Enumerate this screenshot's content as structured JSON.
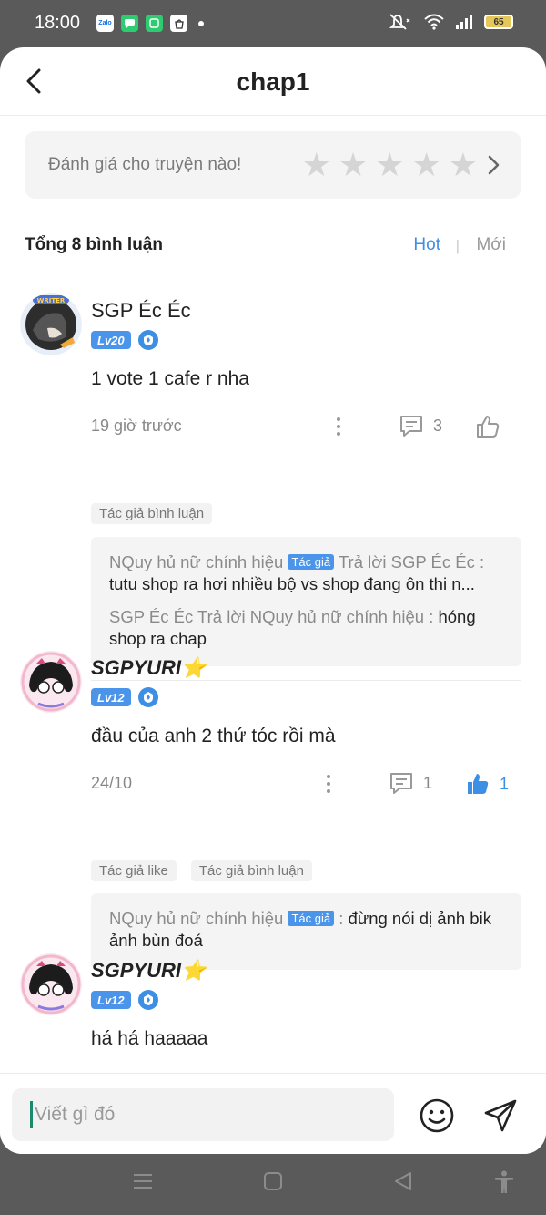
{
  "status_bar": {
    "time": "18:00",
    "notifications": [
      "Zalo",
      "messages",
      "hangouts",
      "shopee"
    ],
    "battery": "65"
  },
  "header": {
    "title": "chap1",
    "back_icon": "chevron-left-icon"
  },
  "rating": {
    "prompt": "Đánh giá cho truyện nào!",
    "stars": 5,
    "filled": 0
  },
  "summary": {
    "total": "Tổng 8 bình luận",
    "sort_hot": "Hot",
    "sort_sep": "|",
    "sort_new": "Mới"
  },
  "comments": [
    {
      "user": "SGP Éc Éc",
      "level": "Lv20",
      "text": "1 vote 1 cafe r nha",
      "time": "19 giờ trước",
      "reply_count": "3",
      "like_count": "",
      "liked": false,
      "tags": [
        "Tác giả bình luận"
      ],
      "replies": [
        {
          "from": "NQuy hủ nữ chính hiệu",
          "author_badge": "Tác giả",
          "verb": "Trả lời",
          "to": "SGP Éc Éc",
          "sep": " :",
          "body": "tutu shop ra hơi nhiều bộ vs shop đang ôn thi n..."
        },
        {
          "from": "SGP Éc Éc",
          "verb": "Trả lời",
          "to": "NQuy hủ nữ chính hiệu",
          "sep": " :",
          "body": " hóng shop ra chap"
        }
      ]
    },
    {
      "user": "SGPYURI⭐",
      "level": "Lv12",
      "text": "đầu của anh 2 thứ tóc rồi mà",
      "time": "24/10",
      "reply_count": "1",
      "like_count": "1",
      "liked": true,
      "tags": [
        "Tác giả like",
        "Tác giả bình luận"
      ],
      "replies": [
        {
          "from": "NQuy hủ nữ chính hiệu",
          "author_badge": "Tác giả",
          "sep": " :",
          "body": " đừng nói dị ảnh bik ảnh bùn đoá"
        }
      ]
    },
    {
      "user": "SGPYURI⭐",
      "level": "Lv12",
      "text": "há há haaaaa"
    }
  ],
  "input": {
    "placeholder": "Viết gì đó"
  },
  "colors": {
    "accent": "#3d8fe4",
    "level_badge": "#4a94ea",
    "status_bar": "#5a5a5a"
  }
}
